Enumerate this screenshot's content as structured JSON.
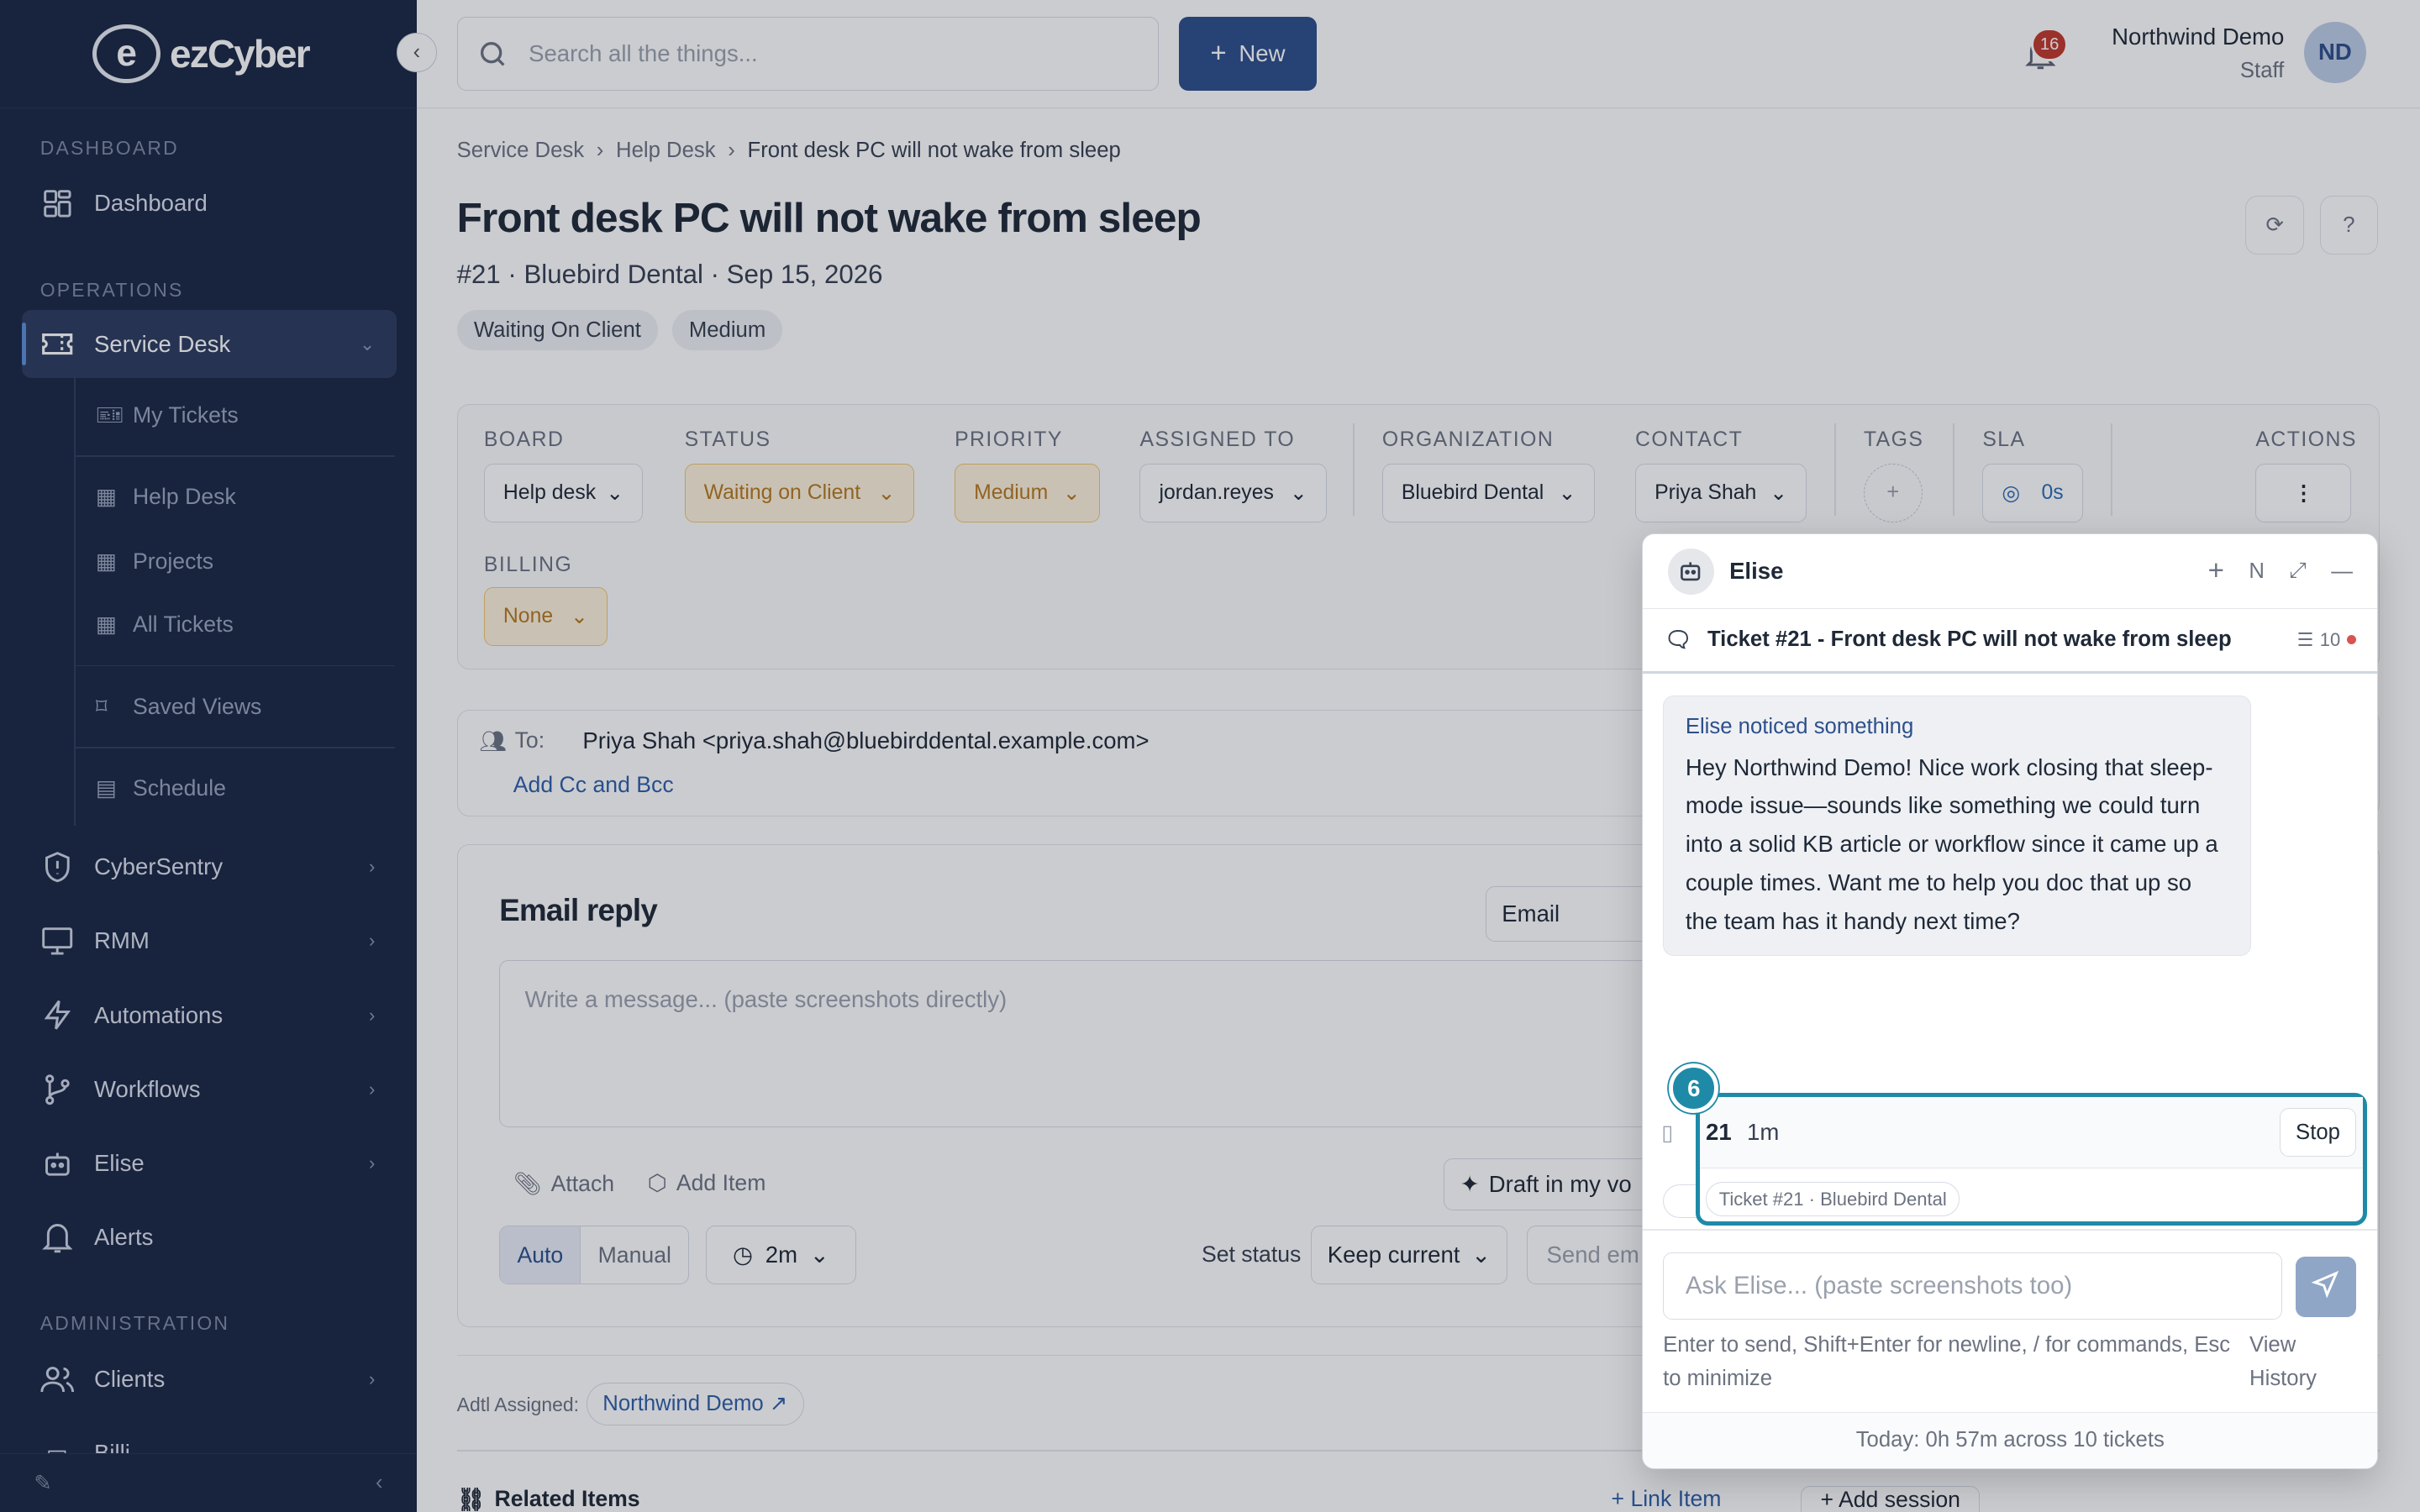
{
  "brand": {
    "logo_letter": "e",
    "name": "ezCyber"
  },
  "sidebar": {
    "sections": {
      "dashboard": "DASHBOARD",
      "operations": "OPERATIONS",
      "administration": "ADMINISTRATION"
    },
    "dashboard": "Dashboard",
    "service_desk": "Service Desk",
    "sub": {
      "my_tickets": "My Tickets",
      "help_desk": "Help Desk",
      "projects": "Projects",
      "all_tickets": "All Tickets",
      "saved_views": "Saved Views",
      "schedule": "Schedule"
    },
    "cybersentry": "CyberSentry",
    "rmm": "RMM",
    "automations": "Automations",
    "workflows": "Workflows",
    "elise": "Elise",
    "alerts": "Alerts",
    "clients": "Clients",
    "billing_partial": "Billi"
  },
  "topbar": {
    "search_placeholder": "Search all the things...",
    "new_label": "New",
    "notifications_count": "16",
    "user_name": "Northwind Demo",
    "user_role": "Staff",
    "user_initials": "ND"
  },
  "breadcrumb": {
    "l1": "Service Desk",
    "l2": "Help Desk",
    "current": "Front desk PC will not wake from sleep"
  },
  "ticket": {
    "title": "Front desk PC will not wake from sleep",
    "meta": "#21 · Bluebird Dental · Sep 15, 2026",
    "chips": [
      "Waiting On Client",
      "Medium"
    ]
  },
  "fields": {
    "board_label": "BOARD",
    "board": "Help desk",
    "status_label": "STATUS",
    "status": "Waiting on Client",
    "priority_label": "PRIORITY",
    "priority": "Medium",
    "assigned_label": "ASSIGNED TO",
    "assigned": "jordan.reyes",
    "org_label": "ORGANIZATION",
    "org": "Bluebird Dental",
    "contact_label": "CONTACT",
    "contact": "Priya Shah",
    "tags_label": "TAGS",
    "sla_label": "SLA",
    "sla": "0s",
    "actions_label": "ACTIONS",
    "billing_label": "BILLING",
    "billing": "None"
  },
  "email": {
    "to_label": "To:",
    "to": "Priya Shah <priya.shah@bluebirddental.example.com>",
    "add_cc": "Add Cc and Bcc",
    "reply_title": "Email reply",
    "channel": "Email",
    "placeholder": "Write a message... (paste screenshots directly)",
    "attach": "Attach",
    "add_item": "Add Item",
    "draft": "Draft in my vo",
    "auto": "Auto",
    "manual": "Manual",
    "delay": "2m",
    "set_status_label": "Set status",
    "set_status": "Keep current",
    "send_partial": "Send em"
  },
  "assigned_extra": {
    "label": "Adtl Assigned:",
    "value": "Northwind Demo ↗"
  },
  "related": {
    "title": "Related Items",
    "link": "Link Item",
    "add_session": "Add session"
  },
  "elise": {
    "title": "Elise",
    "header_letter": "N",
    "ticket_label": "Ticket #21 - Front desk PC will not wake from sleep",
    "count": "10",
    "notice_title": "Elise noticed something",
    "notice_body": "Hey Northwind Demo! Nice work closing that sleep-mode issue—sounds like something we could turn into a solid KB article or workflow since it came up a couple times. Want me to help you doc that up so the team has it handy next time?",
    "timer_ticket": "21",
    "timer_elapsed": "1m",
    "stop": "Stop",
    "timer_tag": "Ticket #21 · Bluebird Dental",
    "step": "6",
    "ask_placeholder": "Ask Elise... (paste screenshots too)",
    "hint": "Enter to send, Shift+Enter for newline, / for commands, Esc to minimize",
    "view_history": "View History",
    "footer": "Today: 0h 57m across 10 tickets"
  }
}
